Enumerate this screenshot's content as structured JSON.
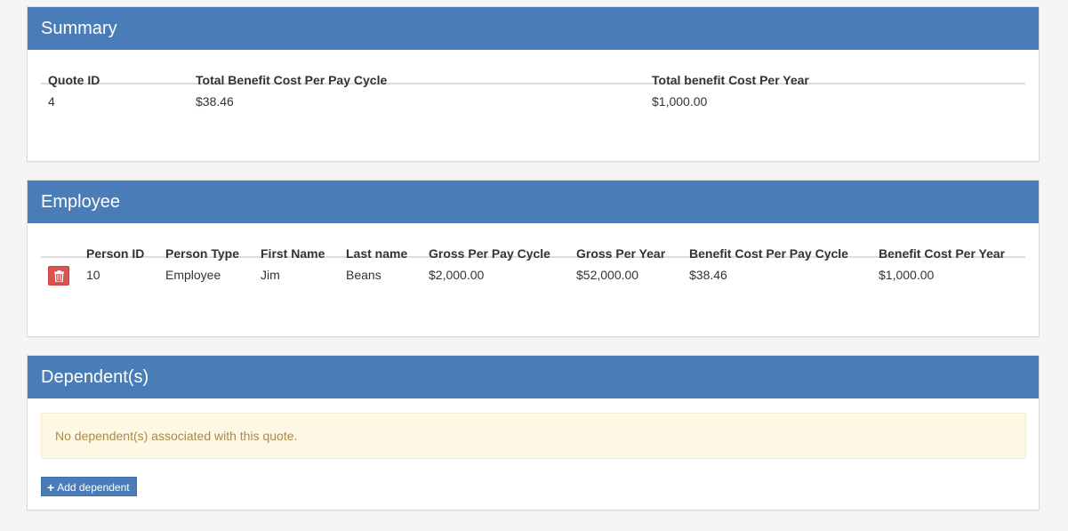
{
  "summary": {
    "title": "Summary",
    "headers": [
      "Quote ID",
      "Total Benefit Cost Per Pay Cycle",
      "Total benefit Cost Per Year"
    ],
    "rows": [
      [
        "4",
        "$38.46",
        "$1,000.00"
      ]
    ]
  },
  "employee": {
    "title": "Employee",
    "headers": [
      "Person ID",
      "Person Type",
      "First Name",
      "Last name",
      "Gross Per Pay Cycle",
      "Gross Per Year",
      "Benefit Cost Per Pay Cycle",
      "Benefit Cost Per Year"
    ],
    "rows": [
      [
        "10",
        "Employee",
        "Jim",
        "Beans",
        "$2,000.00",
        "$52,000.00",
        "$38.46",
        "$1,000.00"
      ]
    ],
    "delete_icon": "trash-icon"
  },
  "dependents": {
    "title": "Dependent(s)",
    "empty_message": "No dependent(s) associated with this quote.",
    "add_label": "Add dependent",
    "add_icon": "plus-icon"
  },
  "colors": {
    "panel_heading": "#4a7db7",
    "danger": "#d9534f",
    "warning_bg": "#fcf8e3",
    "warning_text": "#a98a4d"
  }
}
